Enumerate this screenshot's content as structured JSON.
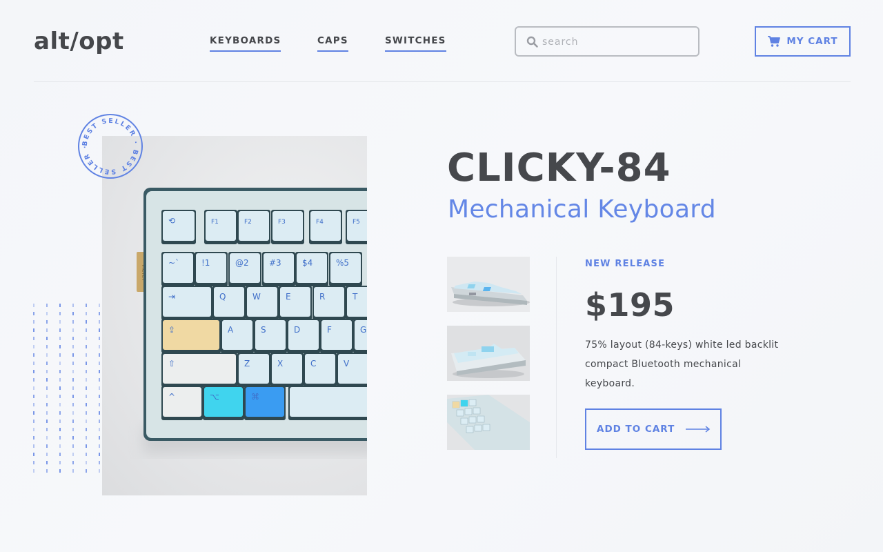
{
  "brand": {
    "logo": "alt/opt"
  },
  "nav": {
    "items": [
      {
        "label": "KEYBOARDS"
      },
      {
        "label": "CAPS"
      },
      {
        "label": "SWITCHES"
      }
    ]
  },
  "search": {
    "placeholder": "search",
    "value": "",
    "icon": "search-icon"
  },
  "cart": {
    "label": "MY CART",
    "icon": "cart-icon"
  },
  "badge": {
    "text": "BEST SELLER · BEST SELLER ·"
  },
  "keyboard_art": {
    "fn_keys": [
      "⟲",
      "F1",
      "F2",
      "F3",
      "F4",
      "F5"
    ],
    "num_keys": [
      "~`",
      "!1",
      "@2",
      "#3",
      "$4",
      "%5"
    ],
    "row_q": [
      "⇥",
      "Q",
      "W",
      "E",
      "R",
      "T"
    ],
    "row_a": [
      "⇪",
      "A",
      "S",
      "D",
      "F",
      "G"
    ],
    "row_z": [
      "⇧",
      "Z",
      "X",
      "C",
      "V"
    ],
    "row_mod": [
      "^",
      "⌥",
      "⌘"
    ],
    "side_label": "VICTEY"
  },
  "product": {
    "title": "CLICKY-84",
    "subtitle": "Mechanical Keyboard",
    "tag": "NEW RELEASE",
    "price": "$195",
    "description": "75% layout (84-keys) white led backlit compact Bluetooth mechanical keyboard.",
    "cta": "ADD TO CART",
    "thumbnails": [
      "thumbnail-side-view",
      "thumbnail-angled-view",
      "thumbnail-top-view"
    ]
  },
  "colors": {
    "accent": "#5f82e3",
    "text": "#45474b",
    "keycap_light": "#dcecf3",
    "keycap_yellow": "#f0d9a3",
    "keycap_cyan": "#40d4ee",
    "keycap_blue": "#3a9cf2"
  }
}
